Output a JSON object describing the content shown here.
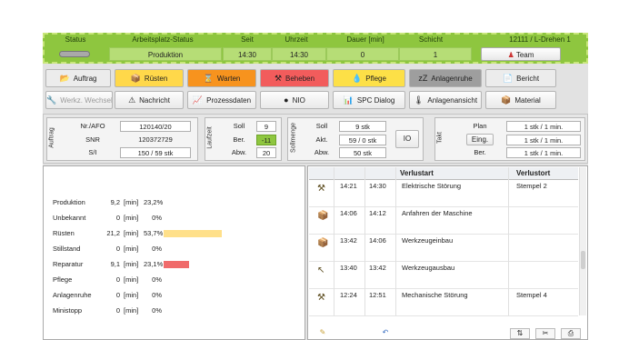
{
  "header": {
    "labels": {
      "status": "Status",
      "workstation": "Arbeitsplatz-Status",
      "since": "Seit",
      "time": "Uhrzeit",
      "duration": "Dauer [min]",
      "shift": "Schicht",
      "machine": "12111 / L-Drehen 1"
    },
    "values": {
      "workstation": "Produktion",
      "since": "14:30",
      "time": "14:30",
      "duration": "0",
      "shift": "1",
      "team": "Team"
    }
  },
  "buttons_row1": [
    {
      "label": "Auftrag",
      "color": "#ececec",
      "icon": "📂"
    },
    {
      "label": "Rüsten",
      "color": "#ffd84a",
      "icon": "📦"
    },
    {
      "label": "Warten",
      "color": "#f7931e",
      "icon": "⌛"
    },
    {
      "label": "Beheben",
      "color": "#f25c5c",
      "icon": "⚒"
    },
    {
      "label": "Pflege",
      "color": "#fde047",
      "icon": "💧"
    },
    {
      "label": "Anlagenruhe",
      "color": "#9e9e9e",
      "icon": "zZ"
    },
    {
      "label": "Bericht",
      "color": "#ececec",
      "icon": "📄"
    }
  ],
  "buttons_row2": [
    {
      "label": "Werkz. Wechsel",
      "icon": "🔧"
    },
    {
      "label": "Nachricht",
      "icon": "⚠"
    },
    {
      "label": "Prozessdaten",
      "icon": "📈"
    },
    {
      "label": "NIO",
      "icon": "●"
    },
    {
      "label": "SPC Dialog",
      "icon": "📊"
    },
    {
      "label": "Anlagenansicht",
      "icon": "🌡"
    },
    {
      "label": "Material",
      "icon": "📦"
    }
  ],
  "auftrag": {
    "title": "Auftrag",
    "rows": [
      [
        "Nr./AFO",
        "120140/20"
      ],
      [
        "SNR",
        "120372729"
      ],
      [
        "S/I",
        "150 / 59 stk"
      ]
    ]
  },
  "laufzeit": {
    "title": "Laufzeit",
    "rows": [
      [
        "Soll",
        "9"
      ],
      [
        "Ber.",
        "-11"
      ],
      [
        "Abw.",
        "20"
      ]
    ]
  },
  "sollmenge": {
    "title": "Sollmenge",
    "rows": [
      [
        "Soll",
        "9 stk"
      ],
      [
        "Akt.",
        "59 / 0 stk"
      ],
      [
        "Abw.",
        "50 stk"
      ]
    ],
    "io": "IO"
  },
  "takt": {
    "title": "Takt",
    "rows": [
      [
        "Plan",
        "1 stk / 1 min."
      ],
      [
        "Eing.",
        "1 stk / 1 min."
      ],
      [
        "Ber.",
        "1 stk / 1 min."
      ]
    ]
  },
  "stats": {
    "unit": "[min]",
    "rows": [
      {
        "label": "Produktion",
        "value": "9,2",
        "pct": "23,2%",
        "fraction": 0,
        "color": ""
      },
      {
        "label": "Unbekannt",
        "value": "0",
        "pct": "0%",
        "fraction": 0,
        "color": ""
      },
      {
        "label": "Rüsten",
        "value": "21,2",
        "pct": "53,7%",
        "fraction": 0.537,
        "color": "#ffe08a"
      },
      {
        "label": "Stillstand",
        "value": "0",
        "pct": "0%",
        "fraction": 0,
        "color": ""
      },
      {
        "label": "Reparatur",
        "value": "9,1",
        "pct": "23,1%",
        "fraction": 0.231,
        "color": "#f06a6a"
      },
      {
        "label": "Pflege",
        "value": "0",
        "pct": "0%",
        "fraction": 0,
        "color": ""
      },
      {
        "label": "Anlagenruhe",
        "value": "0",
        "pct": "0%",
        "fraction": 0,
        "color": ""
      },
      {
        "label": "Ministopp",
        "value": "0",
        "pct": "0%",
        "fraction": 0,
        "color": ""
      }
    ]
  },
  "losses": {
    "headers": {
      "cause": "Verlustart",
      "location": "Verlustort"
    },
    "rows": [
      {
        "icon": "⚒",
        "from": "14:21",
        "to": "14:30",
        "cause": "Elektrische Störung",
        "location": "Stempel 2"
      },
      {
        "icon": "📦",
        "from": "14:06",
        "to": "14:12",
        "cause": "Anfahren der Maschine",
        "location": ""
      },
      {
        "icon": "📦",
        "from": "13:42",
        "to": "14:06",
        "cause": "Werkzeugeinbau",
        "location": ""
      },
      {
        "icon": "↖",
        "from": "13:40",
        "to": "13:42",
        "cause": "Werkzeugausbau",
        "location": ""
      },
      {
        "icon": "⚒",
        "from": "12:24",
        "to": "12:51",
        "cause": "Mechanische Störung",
        "location": "Stempel 4"
      }
    ]
  }
}
